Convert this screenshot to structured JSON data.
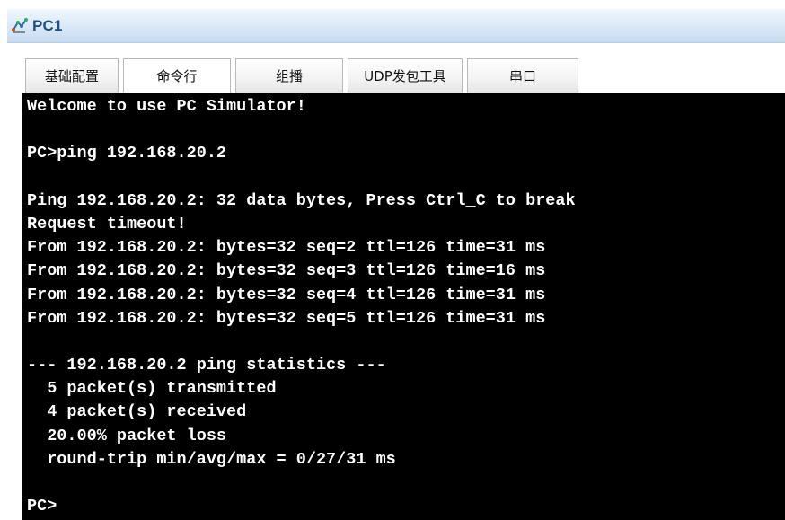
{
  "window": {
    "title": "PC1",
    "icon": "network-pc-icon"
  },
  "tabs": [
    {
      "label": "基础配置",
      "active": false
    },
    {
      "label": "命令行",
      "active": true
    },
    {
      "label": "组播",
      "active": false
    },
    {
      "label": "UDP发包工具",
      "active": false
    },
    {
      "label": "串口",
      "active": false
    }
  ],
  "terminal": {
    "lines": [
      "Welcome to use PC Simulator!",
      "",
      "PC>ping 192.168.20.2",
      "",
      "Ping 192.168.20.2: 32 data bytes, Press Ctrl_C to break",
      "Request timeout!",
      "From 192.168.20.2: bytes=32 seq=2 ttl=126 time=31 ms",
      "From 192.168.20.2: bytes=32 seq=3 ttl=126 time=16 ms",
      "From 192.168.20.2: bytes=32 seq=4 ttl=126 time=31 ms",
      "From 192.168.20.2: bytes=32 seq=5 ttl=126 time=31 ms",
      "",
      "--- 192.168.20.2 ping statistics ---",
      "  5 packet(s) transmitted",
      "  4 packet(s) received",
      "  20.00% packet loss",
      "  round-trip min/avg/max = 0/27/31 ms",
      "",
      "PC>"
    ],
    "background": "#000000",
    "foreground": "#ffffff"
  }
}
